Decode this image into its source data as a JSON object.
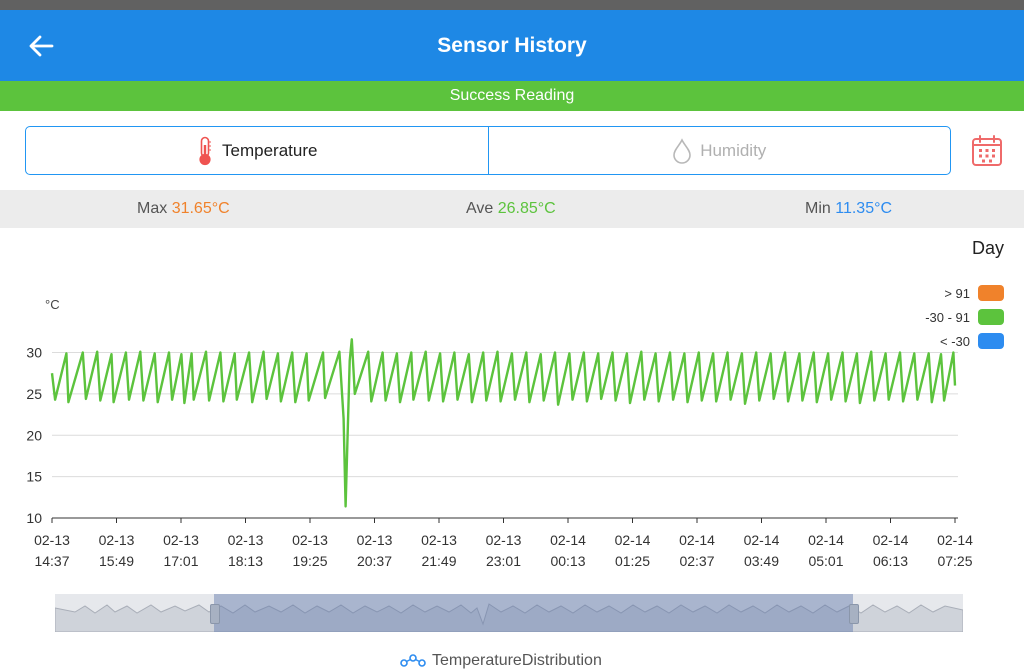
{
  "header": {
    "title": "Sensor History"
  },
  "status": {
    "message": "Success Reading"
  },
  "tabs": [
    {
      "label": "Temperature",
      "active": true
    },
    {
      "label": "Humidity",
      "active": false
    }
  ],
  "stats": {
    "max_label": "Max",
    "max_value": "31.65°C",
    "ave_label": "Ave",
    "ave_value": "26.85°C",
    "min_label": "Min",
    "min_value": "11.35°C"
  },
  "range": "Day",
  "unit": "°C",
  "legend": [
    {
      "label": "> 91",
      "color": "#f0822b"
    },
    {
      "label": "-30 - 91",
      "color": "#5cc33d"
    },
    {
      "label": "< -30",
      "color": "#2d8cf0"
    }
  ],
  "footer": {
    "label": "TemperatureDistribution"
  },
  "colors": {
    "appbar": "#1e88e5",
    "success": "#5cc33d",
    "line": "#5cc33d",
    "accent": "#2196f3"
  },
  "chart_data": {
    "type": "line",
    "ylim": [
      10,
      32
    ],
    "yticks": [
      10,
      15,
      20,
      25,
      30
    ],
    "xticks": [
      [
        "02-13",
        "14:37"
      ],
      [
        "02-13",
        "15:49"
      ],
      [
        "02-13",
        "17:01"
      ],
      [
        "02-13",
        "18:13"
      ],
      [
        "02-13",
        "19:25"
      ],
      [
        "02-13",
        "20:37"
      ],
      [
        "02-13",
        "21:49"
      ],
      [
        "02-13",
        "23:01"
      ],
      [
        "02-14",
        "00:13"
      ],
      [
        "02-14",
        "01:25"
      ],
      [
        "02-14",
        "02:37"
      ],
      [
        "02-14",
        "03:49"
      ],
      [
        "02-14",
        "05:01"
      ],
      [
        "02-14",
        "06:13"
      ],
      [
        "02-14",
        "07:25"
      ]
    ],
    "series": [
      {
        "color": "#5cc33d",
        "points": [
          [
            0,
            27.5
          ],
          [
            0.15,
            24.3
          ],
          [
            0.7,
            29.9
          ],
          [
            0.8,
            24
          ],
          [
            1.5,
            30
          ],
          [
            1.65,
            24.4
          ],
          [
            2.2,
            30.1
          ],
          [
            2.35,
            24.2
          ],
          [
            2.9,
            29.8
          ],
          [
            3.0,
            24
          ],
          [
            3.6,
            30
          ],
          [
            3.75,
            24.3
          ],
          [
            4.3,
            30.1
          ],
          [
            4.45,
            24.2
          ],
          [
            5.0,
            29.9
          ],
          [
            5.15,
            24
          ],
          [
            5.7,
            30
          ],
          [
            5.85,
            24.3
          ],
          [
            6.3,
            29.8
          ],
          [
            6.45,
            23.9
          ],
          [
            6.8,
            29.9
          ],
          [
            6.9,
            24.3
          ],
          [
            7.5,
            30.1
          ],
          [
            7.65,
            24.2
          ],
          [
            8.2,
            30
          ],
          [
            8.35,
            24.1
          ],
          [
            8.9,
            29.9
          ],
          [
            9.0,
            24.3
          ],
          [
            9.6,
            30
          ],
          [
            9.75,
            24
          ],
          [
            10.3,
            30.1
          ],
          [
            10.45,
            24.4
          ],
          [
            11.0,
            29.9
          ],
          [
            11.15,
            24.1
          ],
          [
            11.7,
            30
          ],
          [
            11.85,
            24
          ],
          [
            12.4,
            29.9
          ],
          [
            12.5,
            24.2
          ],
          [
            13.2,
            30
          ],
          [
            13.3,
            24.5
          ],
          [
            14.0,
            30.1
          ],
          [
            14.05,
            28
          ],
          [
            14.2,
            22
          ],
          [
            14.3,
            11.4
          ],
          [
            14.5,
            29
          ],
          [
            14.6,
            31.6
          ],
          [
            14.75,
            25
          ],
          [
            15.4,
            30.1
          ],
          [
            15.55,
            24.1
          ],
          [
            16.1,
            30
          ],
          [
            16.25,
            24.2
          ],
          [
            16.8,
            29.9
          ],
          [
            16.95,
            24
          ],
          [
            17.5,
            30
          ],
          [
            17.6,
            24.3
          ],
          [
            18.2,
            30.1
          ],
          [
            18.35,
            24.2
          ],
          [
            18.9,
            29.9
          ],
          [
            19.05,
            24.1
          ],
          [
            19.6,
            30
          ],
          [
            19.75,
            24.3
          ],
          [
            20.3,
            29.8
          ],
          [
            20.45,
            24
          ],
          [
            21.0,
            30
          ],
          [
            21.15,
            24.2
          ],
          [
            21.7,
            30.1
          ],
          [
            21.85,
            24.1
          ],
          [
            22.4,
            29.9
          ],
          [
            22.55,
            24.3
          ],
          [
            23.1,
            30
          ],
          [
            23.25,
            24
          ],
          [
            23.8,
            29.8
          ],
          [
            23.95,
            24.2
          ],
          [
            24.5,
            30
          ],
          [
            24.65,
            23.7
          ],
          [
            25.2,
            29.9
          ],
          [
            25.35,
            24.3
          ],
          [
            25.9,
            30
          ],
          [
            26.05,
            24.1
          ],
          [
            26.6,
            29.9
          ],
          [
            26.75,
            24.4
          ],
          [
            27.3,
            30
          ],
          [
            27.45,
            24.2
          ],
          [
            28.0,
            29.9
          ],
          [
            28.15,
            23.9
          ],
          [
            28.7,
            30.1
          ],
          [
            28.85,
            24.3
          ],
          [
            29.4,
            29.9
          ],
          [
            29.55,
            24.1
          ],
          [
            30.1,
            30
          ],
          [
            30.25,
            24.3
          ],
          [
            30.8,
            29.9
          ],
          [
            30.95,
            24
          ],
          [
            31.5,
            30
          ],
          [
            31.65,
            24.2
          ],
          [
            32.2,
            29.9
          ],
          [
            32.35,
            24.1
          ],
          [
            32.9,
            30
          ],
          [
            33.05,
            24.3
          ],
          [
            33.6,
            29.9
          ],
          [
            33.75,
            23.8
          ],
          [
            34.3,
            30
          ],
          [
            34.45,
            24.2
          ],
          [
            35.0,
            29.9
          ],
          [
            35.15,
            24.4
          ],
          [
            35.7,
            30
          ],
          [
            35.85,
            24.1
          ],
          [
            36.4,
            29.9
          ],
          [
            36.55,
            24.2
          ],
          [
            37.1,
            30
          ],
          [
            37.25,
            24
          ],
          [
            37.8,
            29.9
          ],
          [
            37.95,
            24.3
          ],
          [
            38.5,
            30
          ],
          [
            38.65,
            24.1
          ],
          [
            39.2,
            29.9
          ],
          [
            39.35,
            23.9
          ],
          [
            39.9,
            30.1
          ],
          [
            40.05,
            24.2
          ],
          [
            40.6,
            29.9
          ],
          [
            40.75,
            24.3
          ],
          [
            41.3,
            30
          ],
          [
            41.45,
            24.1
          ],
          [
            42.0,
            29.9
          ],
          [
            42.15,
            24.3
          ],
          [
            42.7,
            29.9
          ],
          [
            42.85,
            24
          ],
          [
            43.3,
            29.8
          ],
          [
            43.45,
            24.2
          ],
          [
            43.9,
            30
          ],
          [
            43.98,
            26
          ]
        ]
      }
    ]
  }
}
